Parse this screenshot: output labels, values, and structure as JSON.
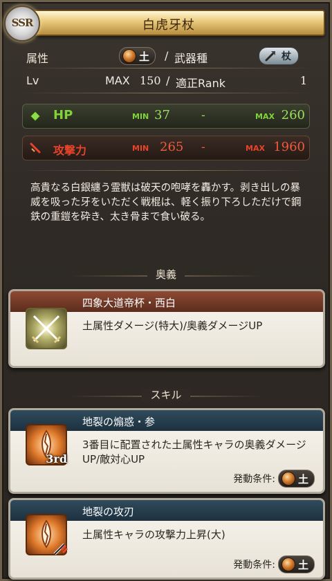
{
  "rarity": "SSR",
  "title": "白虎牙杖",
  "attribute": {
    "label": "属性",
    "element": "土",
    "sep": "/",
    "weapon_label": "武器種",
    "weapon_type": "杖"
  },
  "level": {
    "label": "Lv",
    "max_text": "MAX",
    "max": "150",
    "sep": "/",
    "rank_label": "適正Rank",
    "rank": "1"
  },
  "hp": {
    "label": "HP",
    "min_label": "MIN",
    "min": "37",
    "dash": "-",
    "max_label": "MAX",
    "max": "260"
  },
  "atk": {
    "label": "攻撃力",
    "min_label": "MIN",
    "min": "265",
    "dash": "-",
    "max_label": "MAX",
    "max": "1960"
  },
  "description": "高貴なる白銀纏う霊獣は破天の咆哮を轟かす。剥き出しの暴威を吸った牙をいただく戦棍は、軽く振り下ろしただけで鋼鉄の重鎧を砕き、太き骨まで食い破る。",
  "ougi_section": "奥義",
  "ougi": {
    "name": "四象大道帝杯・西白",
    "effect": "土属性ダメージ(特大)/奥義ダメージUP"
  },
  "skill_section": "スキル",
  "skills": [
    {
      "name": "地裂の煽惑・参",
      "effect": "3番目に配置された土属性キャラの奥義ダメージUP/敵対心UP",
      "badge": "3rd",
      "cond_label": "発動条件:",
      "cond_element": "土"
    },
    {
      "name": "地裂の攻刃",
      "effect": "土属性キャラの攻撃力上昇(大)",
      "cond_label": "発動条件:",
      "cond_element": "土"
    }
  ],
  "colors": {
    "hp_accent": "#7fd43a",
    "atk_accent": "#e8442a",
    "earth": "#d07a2c"
  }
}
